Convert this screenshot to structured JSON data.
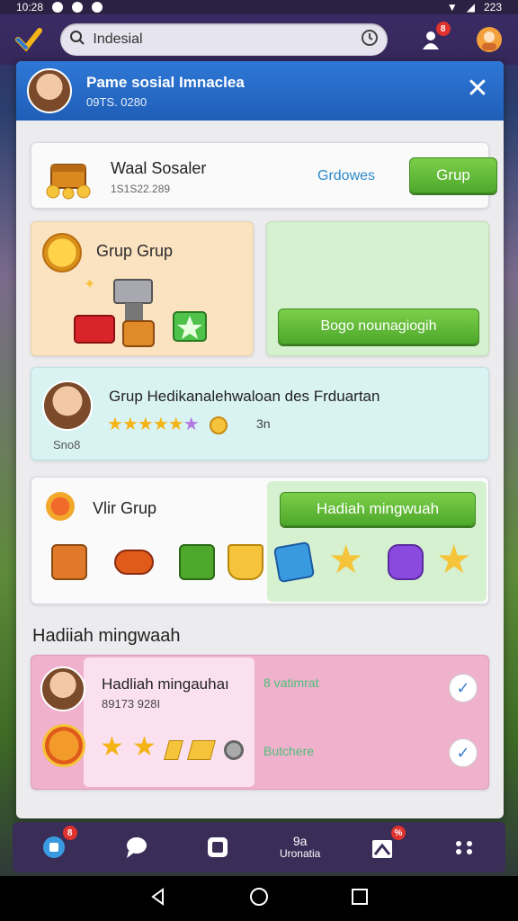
{
  "status": {
    "time": "10:28",
    "battery": "223"
  },
  "search": {
    "placeholder": "Indesial"
  },
  "topbar": {
    "notif_count": "8"
  },
  "header": {
    "title": "Pame sosial Imnaclea",
    "subtitle": "09TS. 0280"
  },
  "card_profile": {
    "name": "Waal Sosaler",
    "id": "1S1S22.289",
    "link": "Grdowes",
    "button": "Grup"
  },
  "card_grup": {
    "label": "Grup Grup"
  },
  "card_green": {
    "button": "Bogo nounagiogih"
  },
  "card_event": {
    "title": "Grup Hedikanalehwaloan des Frduartan",
    "value": "3n",
    "tag": "Sno8",
    "stars_filled": 5,
    "stars_total": 6
  },
  "card_visit": {
    "label": "Vlir Grup",
    "button": "Hadiah mingwuah"
  },
  "section": {
    "title": "Hadiiah mingwaah"
  },
  "card_reward": {
    "name": "Hadliah mingauhaı",
    "id": "89173 928I",
    "right1": "8 vatimrat",
    "right2": "Butchere"
  },
  "bottom_nav": {
    "item1_badge": "8",
    "item4_num": "9a",
    "item4_label": "Uronatia",
    "item5_badge": "%"
  },
  "colors": {
    "accent_blue": "#2f78d6",
    "green": "#5cb833",
    "pink": "#efb1cc",
    "star": "#f5b416"
  },
  "icons": [
    "check-logo-icon",
    "search-icon",
    "clock-icon",
    "notification-icon",
    "user-icon",
    "close-icon",
    "chest-icon",
    "coin-icon",
    "star-icon",
    "sun-icon",
    "check-icon",
    "home-icon",
    "chat-icon",
    "camera-icon",
    "gift-icon",
    "menu-dots-icon",
    "back-icon",
    "home-circle-icon",
    "recent-icon"
  ]
}
